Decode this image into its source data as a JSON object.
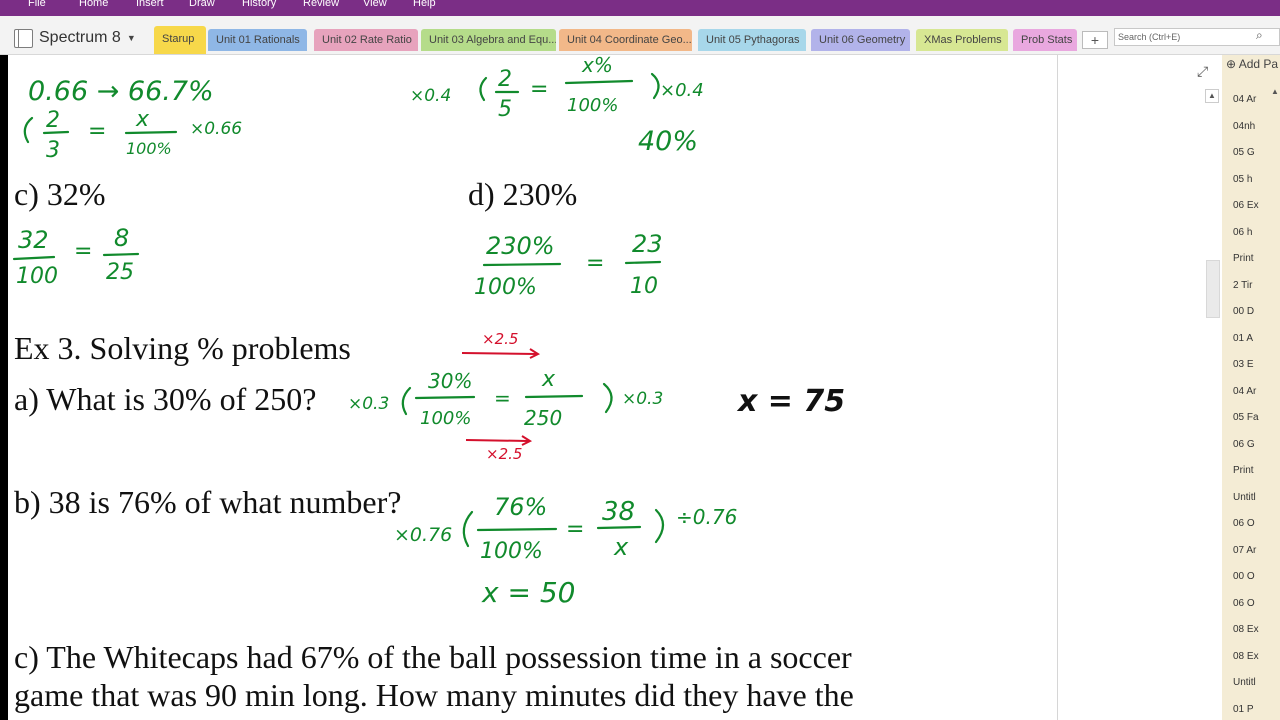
{
  "ribbon": {
    "menus": [
      "File",
      "Home",
      "Insert",
      "Draw",
      "History",
      "Review",
      "View",
      "Help"
    ]
  },
  "notebook": {
    "name": "Spectrum 8"
  },
  "tabs": [
    {
      "label": "Starup",
      "color": "#f7d84a"
    },
    {
      "label": "Unit 01 Rationals",
      "color": "#8fb7e6"
    },
    {
      "label": "Unit 02 Rate Ratio",
      "color": "#e7a3bd"
    },
    {
      "label": "Unit 03 Algebra and Equ...",
      "color": "#b5dc8a"
    },
    {
      "label": "Unit 04 Coordinate Geo...",
      "color": "#f2b889"
    },
    {
      "label": "Unit 05 Pythagoras",
      "color": "#a7d7ea"
    },
    {
      "label": "Unit 06 Geometry",
      "color": "#b2b3ea"
    },
    {
      "label": "XMas Problems",
      "color": "#d7e793"
    },
    {
      "label": "Prob Stats",
      "color": "#e9a8df"
    }
  ],
  "add_tab": "+",
  "search": {
    "placeholder": "Search (Ctrl+E)"
  },
  "note": {
    "c_label": "c) 32%",
    "d_label": "d) 230%",
    "ex3_title": "Ex 3. Solving % problems",
    "a_question": "a) What is 30% of 250?",
    "b_question": "b) 38 is 76% of what number?",
    "c_question_line1": "c) The Whitecaps had 67% of the ball possession time in a soccer",
    "c_question_line2": "game that was 90 min long. How many minutes did they have the"
  },
  "handwriting": {
    "top_left_a": "0.66 → 66.7%",
    "top_left_b1": "2",
    "top_left_b2": "3",
    "top_left_b3": "x",
    "top_left_b4": "100%",
    "top_left_b5": "×0.66",
    "top_right_mul": "×0.4",
    "top_right_n": "2",
    "top_right_d": "5",
    "top_right_x": "x%",
    "top_right_100": "100%",
    "top_right_mul2": "×0.4",
    "top_right_ans": "40%",
    "c_n1": "32",
    "c_d1": "100",
    "c_n2": "8",
    "c_d2": "25",
    "d_n1": "230%",
    "d_d1": "100%",
    "d_n2": "23",
    "d_d2": "10",
    "a_top_red": "×2.5",
    "a_left": "×0.3",
    "a_n1": "30%",
    "a_d1": "100%",
    "a_n2": "x",
    "a_d2": "250",
    "a_right": "×0.3",
    "a_bottom_red": "×2.5",
    "a_answer": "x = 75",
    "b_left": "×0.76",
    "b_n1": "76%",
    "b_d1": "100%",
    "b_n2": "38",
    "b_d2": "x",
    "b_right": "÷0.76",
    "b_answer": "x = 50",
    "eq": "="
  },
  "pages_panel": {
    "add_page": "Add Pa",
    "items": [
      "04 Ar",
      "04nh",
      "05 G",
      "05 h",
      "06 Ex",
      "06 h",
      "Print",
      "2 Tir",
      "00 D",
      "01 A",
      "03 E",
      "04 Ar",
      "05 Fa",
      "06 G",
      "Print",
      "Untitl",
      "06 O",
      "07 Ar",
      "00 O",
      "06 O",
      "08 Ex",
      "08 Ex",
      "Untitl",
      "01 P"
    ]
  },
  "colors": {
    "ribbon": "#7b2e86",
    "ink_green": "#118a2c",
    "ink_red": "#d4102c",
    "pages_bg": "#f4ecd5"
  }
}
